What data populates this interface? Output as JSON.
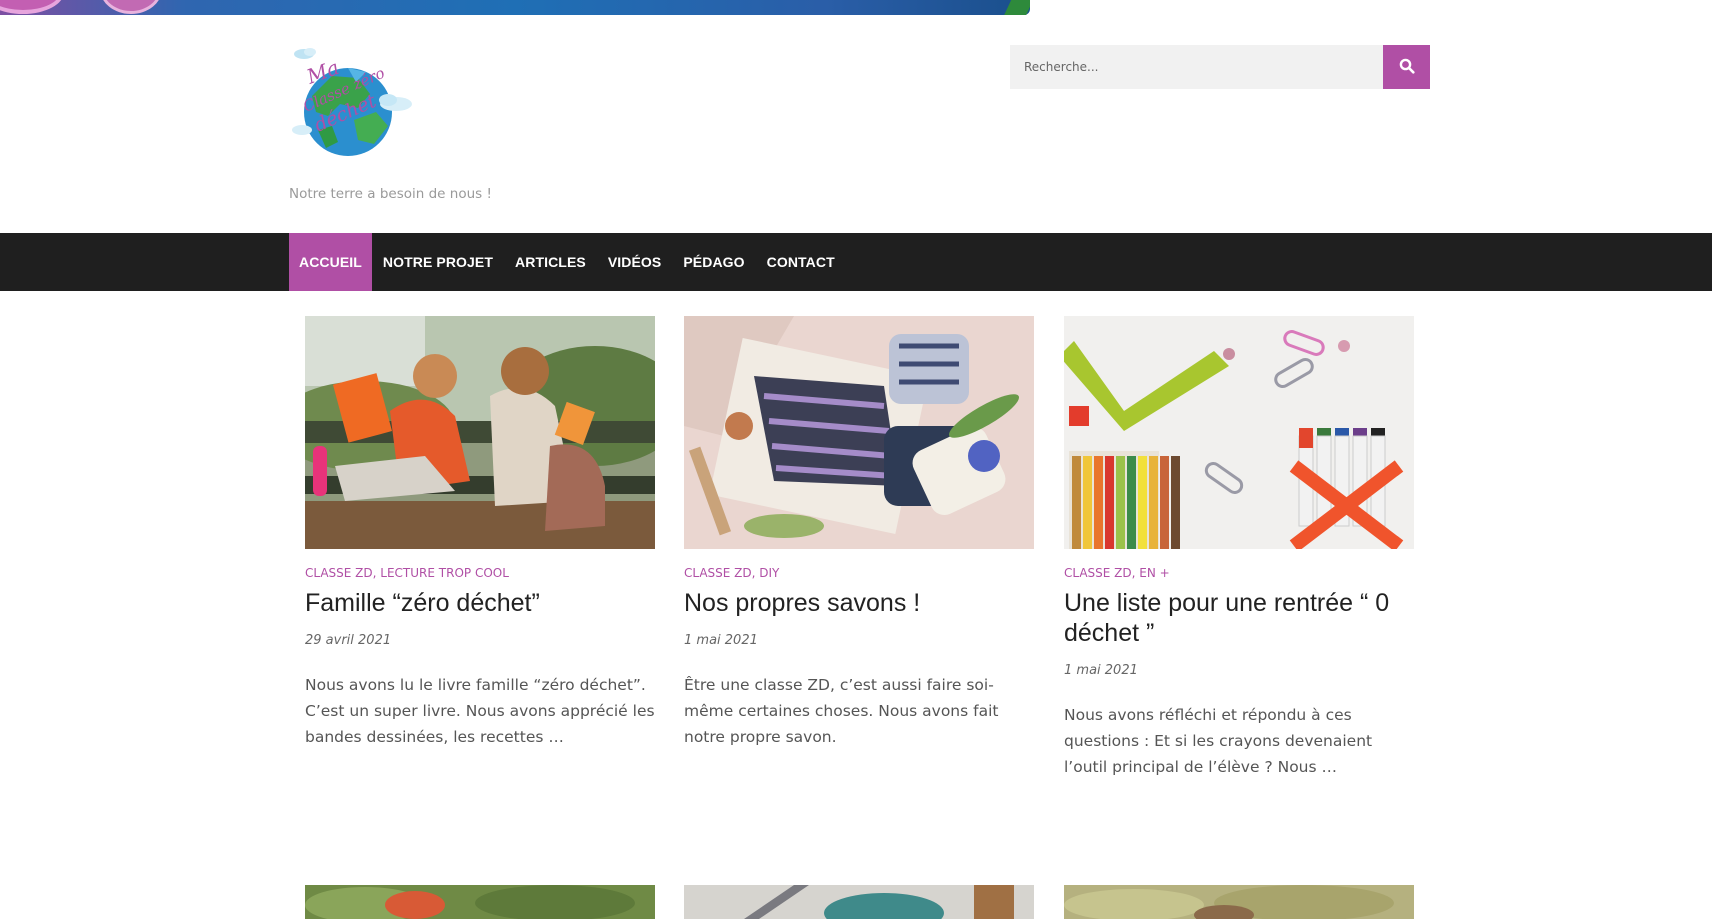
{
  "site": {
    "logo_text": "Ma classe zéro déchet",
    "tagline": "Notre terre a besoin de nous !"
  },
  "search": {
    "placeholder": "Recherche..."
  },
  "nav": {
    "items": [
      {
        "label": "ACCUEIL"
      },
      {
        "label": "NOTRE PROJET"
      },
      {
        "label": "ARTICLES"
      },
      {
        "label": "VIDÉOS"
      },
      {
        "label": "PÉDAGO"
      },
      {
        "label": "CONTACT"
      }
    ]
  },
  "colors": {
    "accent": "#b04fa5",
    "nav_bg": "#1f1f1f"
  },
  "posts": [
    {
      "categories": [
        "CLASSE ZD",
        "LECTURE TROP COOL"
      ],
      "title": "Famille “zéro déchet”",
      "date": "29 avril 2021",
      "excerpt": "Nous avons lu le livre famille “zéro déchet”. C’est un super livre. Nous avons apprécié les bandes dessinées, les recettes …"
    },
    {
      "categories": [
        "CLASSE ZD",
        "DIY"
      ],
      "title": "Nos propres savons !",
      "date": "1 mai 2021",
      "excerpt": "Être une classe ZD, c’est aussi faire soi-même certaines choses. Nous avons fait notre propre savon."
    },
    {
      "categories": [
        "CLASSE ZD",
        "EN +"
      ],
      "title": "Une liste pour une rentrée “ 0 déchet ”",
      "date": "1 mai 2021",
      "excerpt": "Nous avons réfléchi et répondu à ces questions : Et si les crayons devenaient l’outil principal de l’élève ? Nous …"
    }
  ]
}
